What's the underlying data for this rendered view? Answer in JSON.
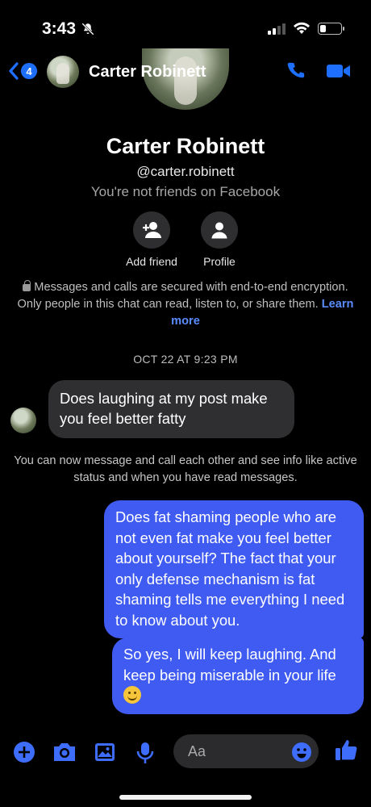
{
  "status_bar": {
    "time": "3:43",
    "silent_icon": "bell-slash-icon",
    "signal_icon": "cellular-signal-icon",
    "wifi_icon": "wifi-icon",
    "battery_icon": "battery-icon",
    "battery_level": 0.3
  },
  "header": {
    "back_badge": "4",
    "contact_name": "Carter Robinett",
    "call_icon": "phone-icon",
    "video_icon": "video-camera-icon"
  },
  "profile": {
    "name": "Carter Robinett",
    "handle": "@carter.robinett",
    "friend_status": "You're not friends on Facebook",
    "actions": [
      {
        "label": "Add friend",
        "icon": "add-person-icon"
      },
      {
        "label": "Profile",
        "icon": "person-icon"
      }
    ],
    "encryption_text": "Messages and calls are secured with end-to-end encryption. Only people in this chat can read, listen to, or share them.",
    "learn_more": "Learn more"
  },
  "conversation": {
    "timestamp": "OCT 22 AT 9:23 PM",
    "incoming": "Does laughing at my post make you feel better fatty",
    "system_notice": "You can now message and call each other and see info like active status and when you have read messages.",
    "outgoing": [
      "Does fat shaming people who are not even fat make you feel better about yourself? The fact that your only defense mechanism is fat shaming tells me everything I need to know about you.",
      "So yes, I will keep laughing. And keep being miserable in your life"
    ],
    "emoji": "smiling-face-emoji"
  },
  "composer": {
    "placeholder": "Aa",
    "icons": [
      "plus-icon",
      "camera-icon",
      "gallery-icon",
      "microphone-icon",
      "emoji-icon",
      "thumbs-up-icon"
    ]
  },
  "colors": {
    "accent": "#1f6fff",
    "outgoing_bubble": "#3f5bf2",
    "incoming_bubble": "#2f2f31",
    "link": "#5b8cff"
  }
}
